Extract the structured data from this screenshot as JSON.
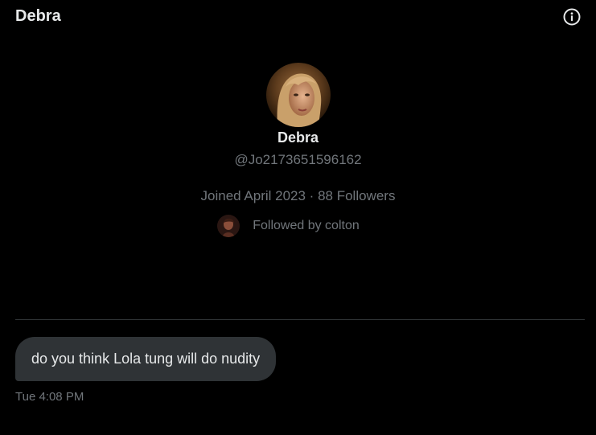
{
  "header": {
    "title": "Debra",
    "info_icon": "info-circle-icon"
  },
  "profile": {
    "name": "Debra",
    "handle": "@Jo2173651596162",
    "meta": "Joined April 2023 · 88 Followers",
    "followed_by": "Followed by colton"
  },
  "messages": [
    {
      "text": "do you think Lola tung will do nudity",
      "time": "Tue 4:08 PM"
    }
  ],
  "colors": {
    "background": "#000000",
    "bubble": "#2f3336",
    "secondary_text": "#71767b",
    "primary_text": "#e7e9ea"
  }
}
